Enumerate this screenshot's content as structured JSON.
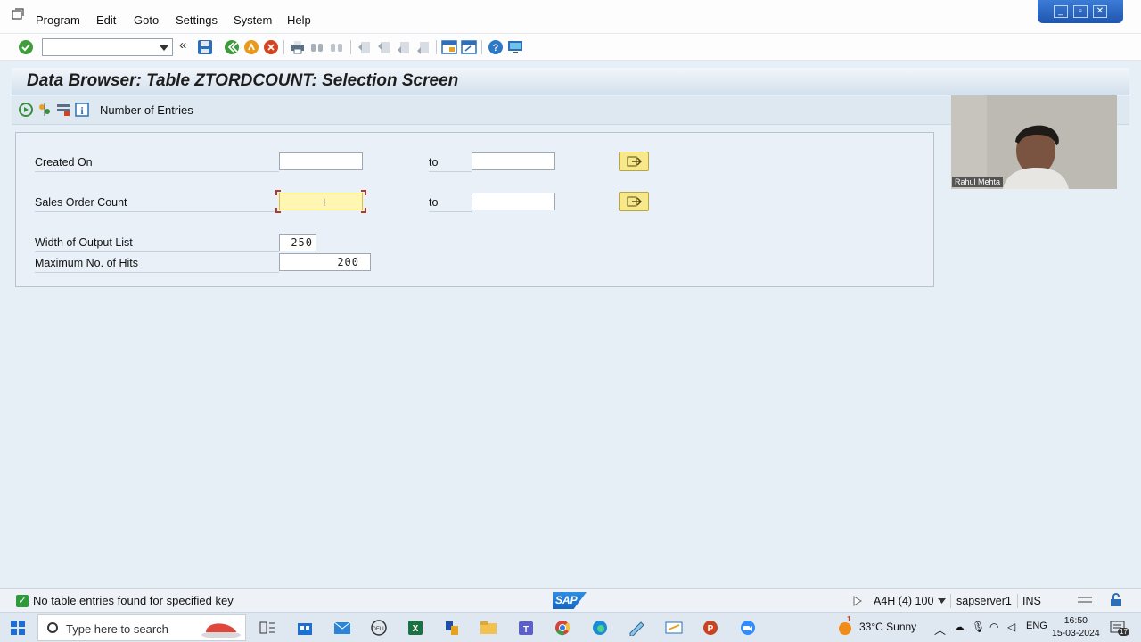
{
  "menu": {
    "items": [
      "Program",
      "Edit",
      "Goto",
      "Settings",
      "System",
      "Help"
    ]
  },
  "toolbar": {
    "command_value": "",
    "icons": [
      "enter-icon",
      "save-icon",
      "back-icon",
      "exit-icon",
      "cancel-icon",
      "print-icon",
      "find-icon",
      "find-next-icon",
      "first-page-icon",
      "previous-page-icon",
      "next-page-icon",
      "last-page-icon",
      "create-session-icon",
      "shortcut-icon",
      "help-icon",
      "customize-layout-icon"
    ]
  },
  "screen": {
    "title": "Data Browser: Table ZTORDCOUNT: Selection Screen",
    "app_toolbar": {
      "number_of_entries_label": "Number of Entries"
    }
  },
  "selection": {
    "rows": [
      {
        "label": "Created On",
        "low": "",
        "to_label": "to",
        "high": ""
      },
      {
        "label": "Sales Order Count",
        "low": "",
        "to_label": "to",
        "high": ""
      }
    ],
    "width_label": "Width of Output List",
    "width_value": "250",
    "max_hits_label": "Maximum No. of Hits",
    "max_hits_value": "200"
  },
  "webcam": {
    "name": "Rahul Mehta"
  },
  "status": {
    "message": "No table entries found for specified key",
    "system": "A4H (4) 100",
    "server": "sapserver1",
    "mode": "INS",
    "logo": "SAP"
  },
  "taskbar": {
    "search_placeholder": "Type here to search",
    "weather": "33°C  Sunny",
    "weather_badge": "1",
    "language": "ENG",
    "time": "16:50",
    "date": "15-03-2024",
    "notification_count": "17"
  }
}
